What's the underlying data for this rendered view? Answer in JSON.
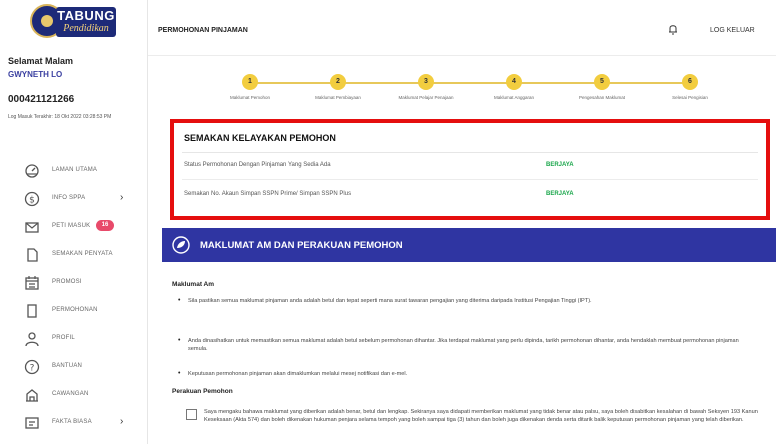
{
  "sidebar": {
    "logo_line1": "TABUNG",
    "logo_line2": "Pendidikan",
    "greeting": "Selamat Malam",
    "user_name": "GWYNETH LO",
    "user_id": "000421121266",
    "last_login": "Log Masuk Terakhir: 18 Okt 2022 03:28:53 PM",
    "items": [
      {
        "label": "LAMAN UTAMA",
        "icon": "dashboard-icon",
        "chevron": "",
        "badge": ""
      },
      {
        "label": "INFO SPPA",
        "icon": "dollar-circle-icon",
        "chevron": "›",
        "badge": ""
      },
      {
        "label": "PETI MASUK",
        "icon": "mail-icon",
        "chevron": "",
        "badge": "16"
      },
      {
        "label": "SEMAKAN PENYATA",
        "icon": "document-icon",
        "chevron": "",
        "badge": ""
      },
      {
        "label": "PROMOSI",
        "icon": "calendar-icon",
        "chevron": "",
        "badge": ""
      },
      {
        "label": "PERMOHONAN",
        "icon": "form-icon",
        "chevron": "",
        "badge": ""
      },
      {
        "label": "PROFIL",
        "icon": "user-icon",
        "chevron": "",
        "badge": ""
      },
      {
        "label": "BANTUAN",
        "icon": "help-circle-icon",
        "chevron": "",
        "badge": ""
      },
      {
        "label": "CAWANGAN",
        "icon": "building-icon",
        "chevron": "",
        "badge": ""
      },
      {
        "label": "FAKTA BIASA",
        "icon": "faq-icon",
        "chevron": "›",
        "badge": ""
      }
    ]
  },
  "header": {
    "title": "PERMOHONAN PINJAMAN",
    "logout_label": "LOG KELUAR"
  },
  "stepper": {
    "steps": [
      {
        "num": "1",
        "label": "Maklumat Pemohon"
      },
      {
        "num": "2",
        "label": "Maklumat Pembiayaan"
      },
      {
        "num": "3",
        "label": "Maklumat Pelajar Penajaan"
      },
      {
        "num": "4",
        "label": "Maklumat Anggaran"
      },
      {
        "num": "5",
        "label": "Pengesahan Maklumat"
      },
      {
        "num": "6",
        "label": "Selesai Pengisian"
      }
    ]
  },
  "eligibility": {
    "title": "SEMAKAN KELAYAKAN PEMOHON",
    "rows": [
      {
        "question": "Status Permohonan Dengan Pinjaman Yang Sedia Ada",
        "answer": "BERJAYA"
      },
      {
        "question": "Semakan No. Akaun Simpan SSPN Prime/ Simpan SSPN Plus",
        "answer": "BERJAYA"
      }
    ]
  },
  "banner": {
    "title": "MAKLUMAT AM DAN PERAKUAN PEMOHON"
  },
  "general": {
    "heading": "Maklumat Am",
    "bullets": [
      "Sila pastikan semua maklumat pinjaman anda adalah betul dan tepat seperti mana surat tawaran pengajian yang diterima daripada Institusi Pengajian Tinggi (IPT).",
      "Anda dinasihatkan untuk memastikan semua maklumat adalah betul sebelum permohonan dihantar. Jika terdapat maklumat yang perlu dipinda, tarikh permohonan dihantar, anda hendaklah membuat permohonan pinjaman semula.",
      "Keputusan permohonan pinjaman akan dimaklumkan melalui mesej notifikasi dan e-mel."
    ]
  },
  "declaration": {
    "heading": "Perakuan Pemohon",
    "text": "Saya mengaku bahawa maklumat yang diberikan adalah benar, betul dan lengkap. Sekiranya saya didapati memberikan maklumat yang tidak benar atau palsu, saya boleh disabitkan kesalahan di bawah Seksyen 193 Kanun Keseksaan (Akta 574) dan boleh dikenakan hukuman penjara selama tempoh yang boleh sampai tiga (3) tahun dan boleh juga dikenakan denda serta ditarik balik keputusan permohonan pinjaman yang telah diberikan."
  },
  "colors": {
    "brand_blue": "#2f35a2",
    "highlight_red": "#e50e0e",
    "success_green": "#19a64a",
    "step_yellow": "#f2cd3f",
    "badge_pink": "#e84a6a"
  }
}
